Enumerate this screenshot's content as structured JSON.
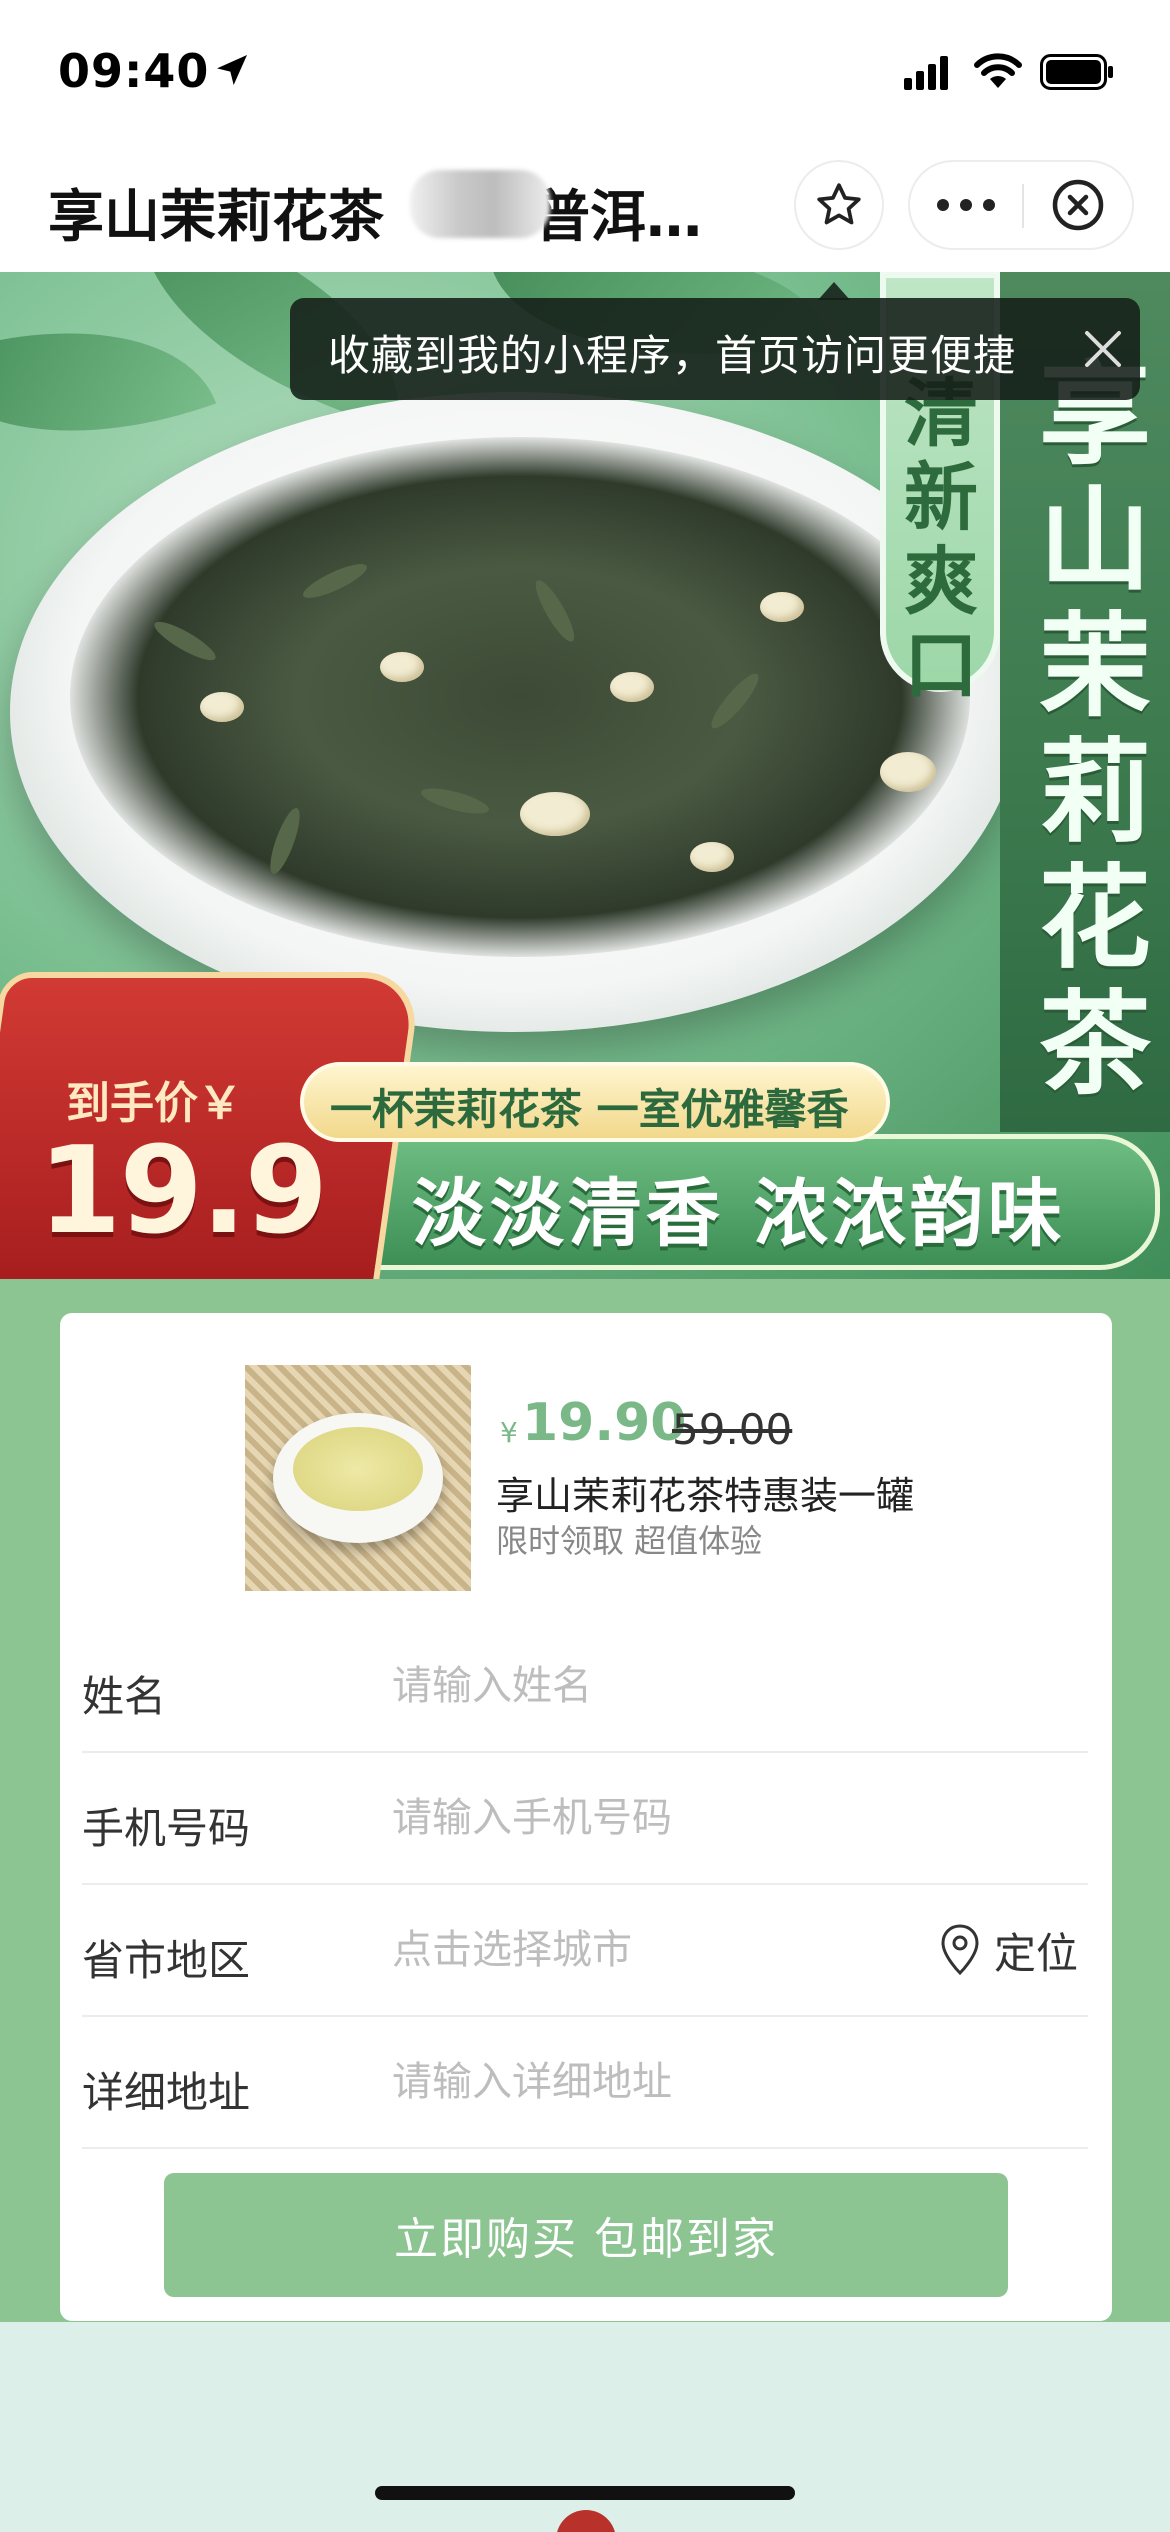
{
  "status_bar": {
    "time": "09:40"
  },
  "nav": {
    "title": "享山茉莉花茶",
    "title_suffix": "普洱…"
  },
  "toast": {
    "text": "收藏到我的小程序，首页访问更便捷"
  },
  "banner": {
    "vertical_title": "享山茉莉花茶",
    "vertical_tag": "清新爽口",
    "price_label": "到手价￥",
    "price": "19.9",
    "slogan_small": "一杯茉莉花茶 一室优雅馨香",
    "slogan_big": "淡淡清香  浓浓韵味"
  },
  "product": {
    "currency": "¥",
    "price": "19.90",
    "original_price": "59.00",
    "name": "享山茉莉花茶特惠装一罐",
    "subtitle": "限时领取 超值体验"
  },
  "form": {
    "fields": [
      {
        "label": "姓名",
        "placeholder": "请输入姓名"
      },
      {
        "label": "手机号码",
        "placeholder": "请输入手机号码"
      },
      {
        "label": "省市地区",
        "placeholder": "点击选择城市"
      },
      {
        "label": "详细地址",
        "placeholder": "请输入详细地址"
      }
    ],
    "locate_label": "定位",
    "submit_label": "立即购买 包邮到家"
  },
  "colors": {
    "accent_green": "#8cc592",
    "price_green": "#7ab987",
    "badge_red": "#c2302d"
  }
}
